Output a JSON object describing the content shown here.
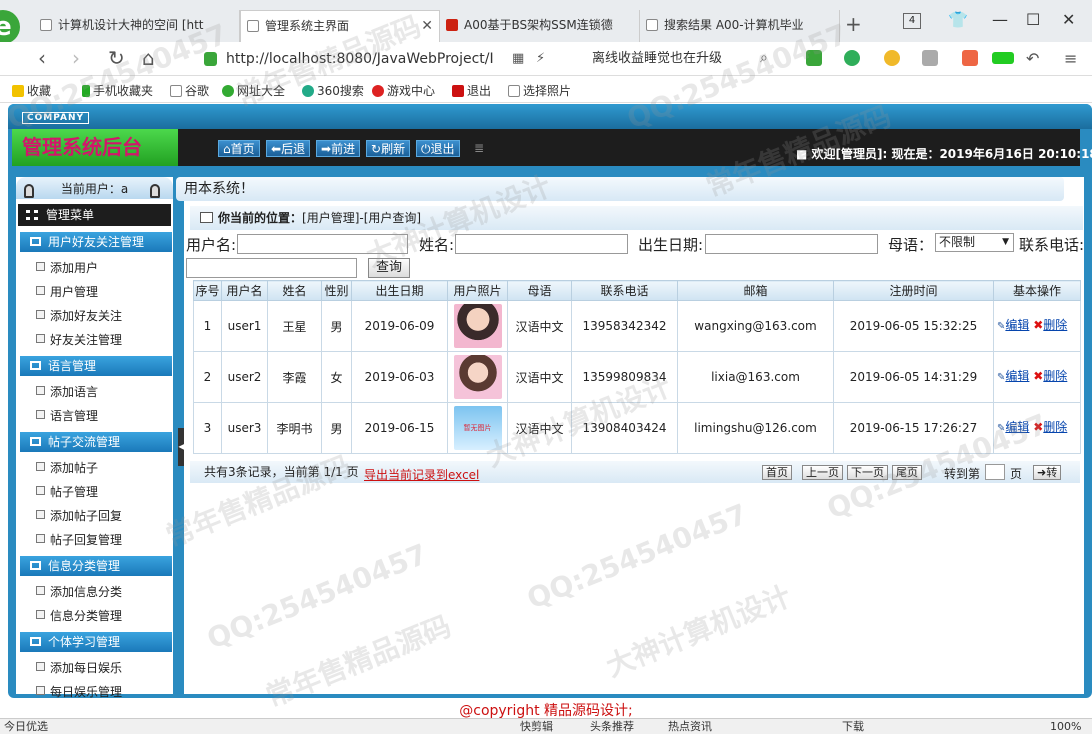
{
  "browser": {
    "tabs": [
      {
        "label": "计算机设计大神的空间 [htt"
      },
      {
        "label": "管理系统主界面"
      },
      {
        "label": "A00基于BS架构SSM连锁德"
      },
      {
        "label": "搜索结果 A00-计算机毕业"
      }
    ],
    "tab_count": "4",
    "url": "http://localhost:8080/JavaWebProject/I",
    "search_text": "离线收益睡觉也在升级",
    "bookmarks": [
      "收藏",
      "手机收藏夹",
      "谷歌",
      "网址大全",
      "360搜索",
      "游戏中心",
      "退出",
      "选择照片"
    ]
  },
  "app": {
    "company": "COMPANY",
    "title": "管理系统后台",
    "top_buttons": [
      "首页",
      "后退",
      "前进",
      "刷新",
      "退出"
    ],
    "welcome": "■ 欢迎[管理员]: 现在是：2019年6月16日 20:10:18",
    "marquee": "用本系统！"
  },
  "sidebar": {
    "current_user": "当前用户：a",
    "menu_title": "管理菜单",
    "groups": [
      {
        "title": "用户好友关注管理",
        "items": [
          "添加用户",
          "用户管理",
          "添加好友关注",
          "好友关注管理"
        ]
      },
      {
        "title": "语言管理",
        "items": [
          "添加语言",
          "语言管理"
        ]
      },
      {
        "title": "帖子交流管理",
        "items": [
          "添加帖子",
          "帖子管理",
          "添加帖子回复",
          "帖子回复管理"
        ]
      },
      {
        "title": "信息分类管理",
        "items": [
          "添加信息分类",
          "信息分类管理"
        ]
      },
      {
        "title": "个体学习管理",
        "items": [
          "添加每日娱乐",
          "每日娱乐管理"
        ]
      }
    ]
  },
  "breadcrumb": {
    "label": "你当前的位置：",
    "path": "[用户管理]-[用户查询]"
  },
  "search": {
    "username_label": "用户名:",
    "name_label": "姓名:",
    "birth_label": "出生日期:",
    "language_label": "母语：",
    "language_value": "不限制",
    "phone_label": "联系电话:",
    "query_button": "查询"
  },
  "table": {
    "headers": [
      "序号",
      "用户名",
      "姓名",
      "性别",
      "出生日期",
      "用户照片",
      "母语",
      "联系电话",
      "邮箱",
      "注册时间",
      "基本操作"
    ],
    "rows": [
      {
        "no": "1",
        "username": "user1",
        "name": "王星",
        "gender": "男",
        "birth": "2019-06-09",
        "photo": "",
        "language": "汉语中文",
        "phone": "13958342342",
        "email": "wangxing@163.com",
        "reg_time": "2019-06-05 15:32:25"
      },
      {
        "no": "2",
        "username": "user2",
        "name": "李霞",
        "gender": "女",
        "birth": "2019-06-03",
        "photo": "",
        "language": "汉语中文",
        "phone": "13599809834",
        "email": "lixia@163.com",
        "reg_time": "2019-06-05 14:31:29"
      },
      {
        "no": "3",
        "username": "user3",
        "name": "李明书",
        "gender": "男",
        "birth": "2019-06-15",
        "photo": "暂无图片",
        "language": "汉语中文",
        "phone": "13908403424",
        "email": "limingshu@126.com",
        "reg_time": "2019-06-15 17:26:27"
      }
    ],
    "edit_label": "编辑",
    "delete_label": "删除"
  },
  "pager": {
    "summary": "共有3条记录，当前第 1/1 页",
    "export": "导出当前记录到excel",
    "first": "首页",
    "prev": "上一页",
    "next": "下一页",
    "last": "尾页",
    "goto": "转到第",
    "page": "页",
    "go": "➜转"
  },
  "footer": {
    "copyright": "@copyright 精品源码设计;"
  },
  "statusbar": {
    "left": "今日优选",
    "items": [
      "快剪辑",
      "头条推荐",
      "热点资讯",
      "下载"
    ],
    "zoom": "100%"
  },
  "watermarks": [
    "QQ:254540457",
    "常年售精品源码",
    "大神计算机设计",
    "QQ:254540457",
    "常年售精品源码",
    "大神计算机设计",
    "QQ:254540457",
    "常年售精品源码",
    "QQ:254540457",
    "大神计算机设计",
    "常年售精品源码",
    "QQ:254540457"
  ]
}
